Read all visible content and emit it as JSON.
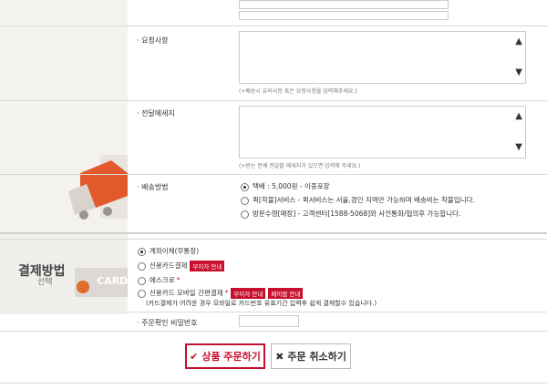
{
  "form": {
    "request": {
      "label": "요청사항",
      "hint": "(+배송시 유의사항 혹은 요청사항을 입력해주세요.)"
    },
    "message": {
      "label": "전달메세지",
      "hint": "(+받는 분께 전달할 메세지가 있으면 입력해 주세요.)"
    },
    "shipping": {
      "label": "배송방법",
      "options": [
        "택배 : 5,000원 - 이중포장",
        "퀵[착불]서비스 - 퀵서비스는 서울,경인 지역만 가능하며 배송비는 착불입니다.",
        "방문수령[매장] - 고객센터[1588-5068]와 사전통화/협의후 가능합니다."
      ]
    }
  },
  "payment": {
    "title": "결제방법",
    "subtitle": "선택",
    "card_text": "CARD",
    "options": {
      "bank": "계좌이체(무통장)",
      "card": "신용카드결제",
      "card_badge": "무이자 안내",
      "escrow": "에스크로",
      "mobile": "신용카드 모바일 간편결제",
      "mobile_badge1": "무이자 안내",
      "mobile_badge2": "페이팝 안내",
      "mobile_note": "(카드결제가 어려운 경우 모바일로 카드번호 유효기간 입력후 쉽게 결제할수 있습니다.)"
    },
    "order_password_label": "주문확인 비밀번호"
  },
  "buttons": {
    "submit": "상품 주문하기",
    "cancel": "주문 취소하기"
  },
  "colors": {
    "accent": "#c8102e",
    "orange": "#e06b2a"
  }
}
